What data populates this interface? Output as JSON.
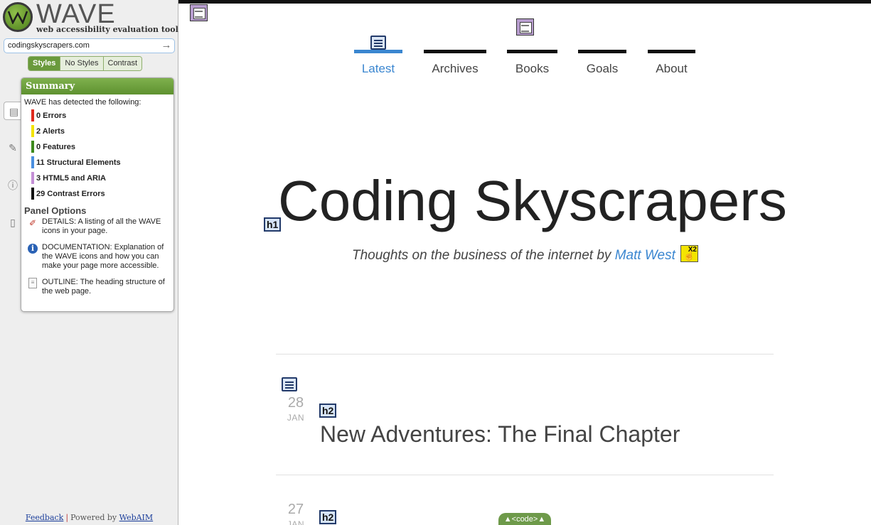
{
  "wave": {
    "logo_word": "WAVE",
    "logo_tagline": "web accessibility evaluation tool",
    "url_value": "codingskyscrapers.com",
    "style_toggle": [
      "Styles",
      "No Styles",
      "Contrast"
    ],
    "panel": {
      "title": "Summary",
      "intro": "WAVE has detected the following:",
      "summary": [
        {
          "label": "0 Errors",
          "color": "#e02a1e"
        },
        {
          "label": "2 Alerts",
          "color": "#f4e400"
        },
        {
          "label": "0 Features",
          "color": "#3d8a1d"
        },
        {
          "label": "11 Structural Elements",
          "color": "#4a8fe0"
        },
        {
          "label": "3 HTML5 and ARIA",
          "color": "#c48fd6"
        },
        {
          "label": "29 Contrast Errors",
          "color": "#111111"
        }
      ],
      "options_heading": "Panel Options",
      "options": [
        {
          "icon": "pushpin-icon",
          "text": "DETAILS: A listing of all the WAVE icons in your page."
        },
        {
          "icon": "info-icon",
          "text": "DOCUMENTATION: Explanation of the WAVE icons and how you can make your page more accessible."
        },
        {
          "icon": "document-icon",
          "text": "OUTLINE: The heading structure of the web page."
        }
      ]
    },
    "footer": {
      "feedback": "Feedback",
      "powered": "Powered by",
      "webaim": "WebAIM"
    }
  },
  "site": {
    "nav": [
      "Latest",
      "Archives",
      "Books",
      "Goals",
      "About"
    ],
    "nav_active": "Latest",
    "title": "Coding Skyscrapers",
    "tagline_prefix": "Thoughts on the business of the internet by",
    "tagline_author": "Matt West",
    "alert_count": "X2",
    "posts": [
      {
        "day": "28",
        "month": "JAN",
        "title": "New Adventures: The Final Chapter"
      },
      {
        "day": "27",
        "month": "JAN",
        "title": ""
      }
    ],
    "badges": {
      "h1": "h1",
      "h2": "h2",
      "code": "<code>"
    }
  }
}
